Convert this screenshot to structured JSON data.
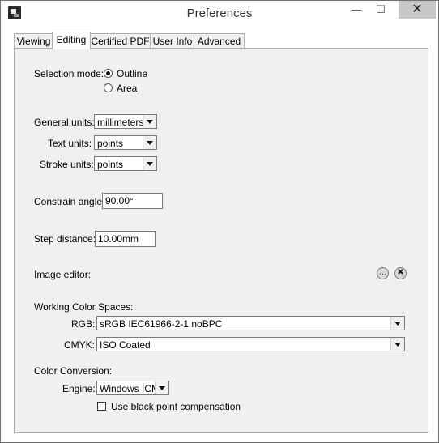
{
  "window": {
    "title": "Preferences",
    "minimize": "—",
    "maximize": "☐",
    "close": "✕"
  },
  "tabs": [
    "Viewing",
    "Editing",
    "Certified PDF",
    "User Info",
    "Advanced"
  ],
  "active_tab": "Editing",
  "selection_mode": {
    "label": "Selection mode:",
    "options": [
      "Outline",
      "Area"
    ],
    "selected": "Outline"
  },
  "units": {
    "general_label": "General units:",
    "general_value": "millimeters",
    "text_label": "Text units:",
    "text_value": "points",
    "stroke_label": "Stroke units:",
    "stroke_value": "points"
  },
  "constrain_angle": {
    "label": "Constrain angle:",
    "value": "90.00°"
  },
  "step_distance": {
    "label": "Step distance:",
    "value": "10.00mm"
  },
  "image_editor": {
    "label": "Image editor:",
    "browse_glyph": "…",
    "clear_glyph": "✖"
  },
  "working_color_spaces": {
    "heading": "Working Color Spaces:",
    "rgb_label": "RGB:",
    "rgb_value": "sRGB IEC61966-2-1 noBPC",
    "cmyk_label": "CMYK:",
    "cmyk_value": "ISO Coated"
  },
  "color_conversion": {
    "heading": "Color Conversion:",
    "engine_label": "Engine:",
    "engine_value": "Windows ICM",
    "black_point_label": "Use black point compensation",
    "black_point_checked": false
  }
}
